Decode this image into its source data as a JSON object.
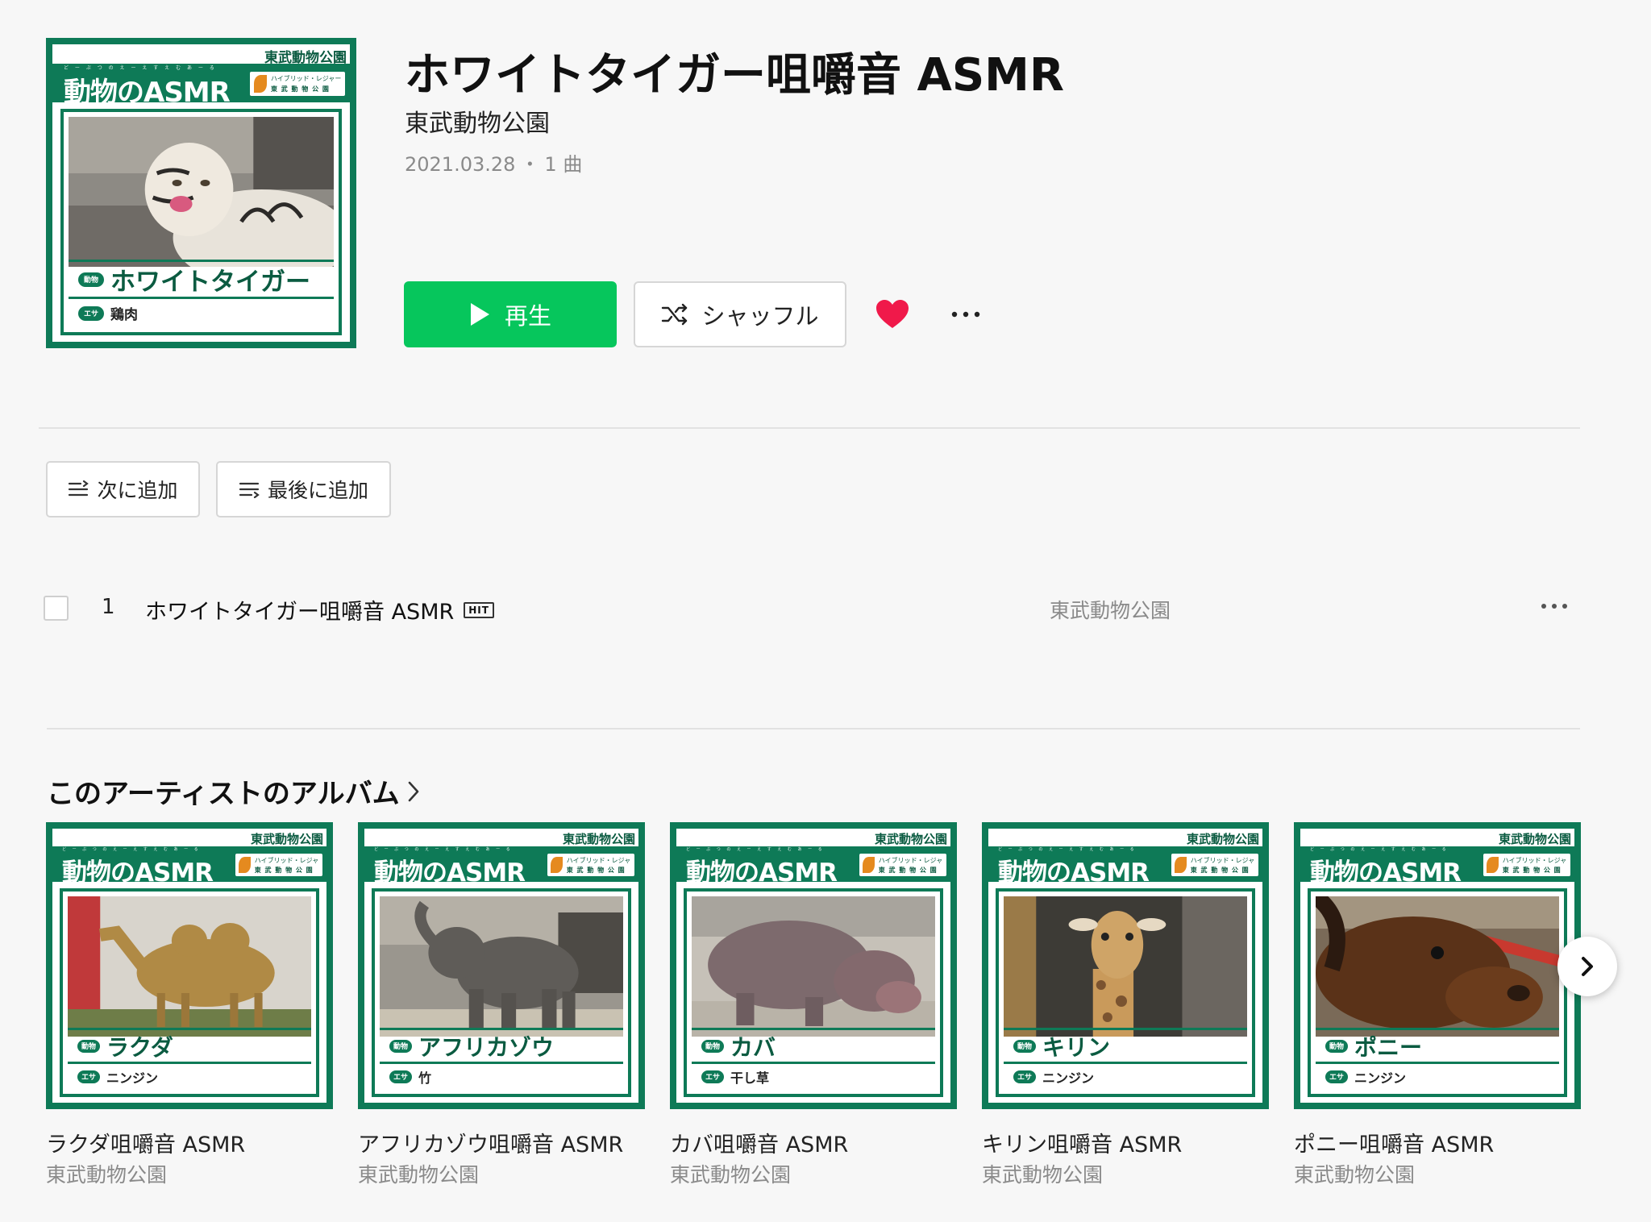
{
  "album": {
    "title": "ホワイトタイガー咀嚼音 ASMR",
    "artist": "東武動物公園",
    "date": "2021.03.28",
    "separator": "・",
    "track_count": "1 曲",
    "cover": {
      "zoo": "東武動物公園",
      "title": "動物のASMR",
      "ruby": "ど ー ぶ つ の え ー え す え む あ ー る",
      "logo_line1": "ハイブリッド・レジャーランド",
      "logo_line2": "東 武 動 物 公 園",
      "animal_tag": "動物",
      "animal": "ホワイトタイガー",
      "feed_tag": "エサ",
      "feed": "鶏肉"
    }
  },
  "actions": {
    "play": "再生",
    "shuffle": "シャッフル",
    "add_next": "次に追加",
    "add_last": "最後に追加"
  },
  "tracks": [
    {
      "number": "1",
      "title": "ホワイトタイガー咀嚼音 ASMR",
      "badge": "HIT",
      "artist": "東武動物公園"
    }
  ],
  "artist_albums": {
    "section_title": "このアーティストのアルバム",
    "items": [
      {
        "title": "ラクダ咀嚼音 ASMR",
        "artist": "東武動物公園",
        "animal": "ラクダ",
        "feed": "ニンジン"
      },
      {
        "title": "アフリカゾウ咀嚼音 ASMR",
        "artist": "東武動物公園",
        "animal": "アフリカゾウ",
        "feed": "竹"
      },
      {
        "title": "カバ咀嚼音 ASMR",
        "artist": "東武動物公園",
        "animal": "カバ",
        "feed": "干し草"
      },
      {
        "title": "キリン咀嚼音 ASMR",
        "artist": "東武動物公園",
        "animal": "キリン",
        "feed": "ニンジン"
      },
      {
        "title": "ポニー咀嚼音 ASMR",
        "artist": "東武動物公園",
        "animal": "ポニー",
        "feed": "ニンジン"
      }
    ]
  },
  "colors": {
    "play_green": "#06c65c",
    "jacket_green": "#0e7a57",
    "heart": "#f0194a",
    "muted_text": "#8a8a8a"
  },
  "icons": [
    "play-icon",
    "shuffle-icon",
    "heart-icon",
    "more-icon",
    "add-next-icon",
    "add-last-icon",
    "chevron-right-icon"
  ]
}
